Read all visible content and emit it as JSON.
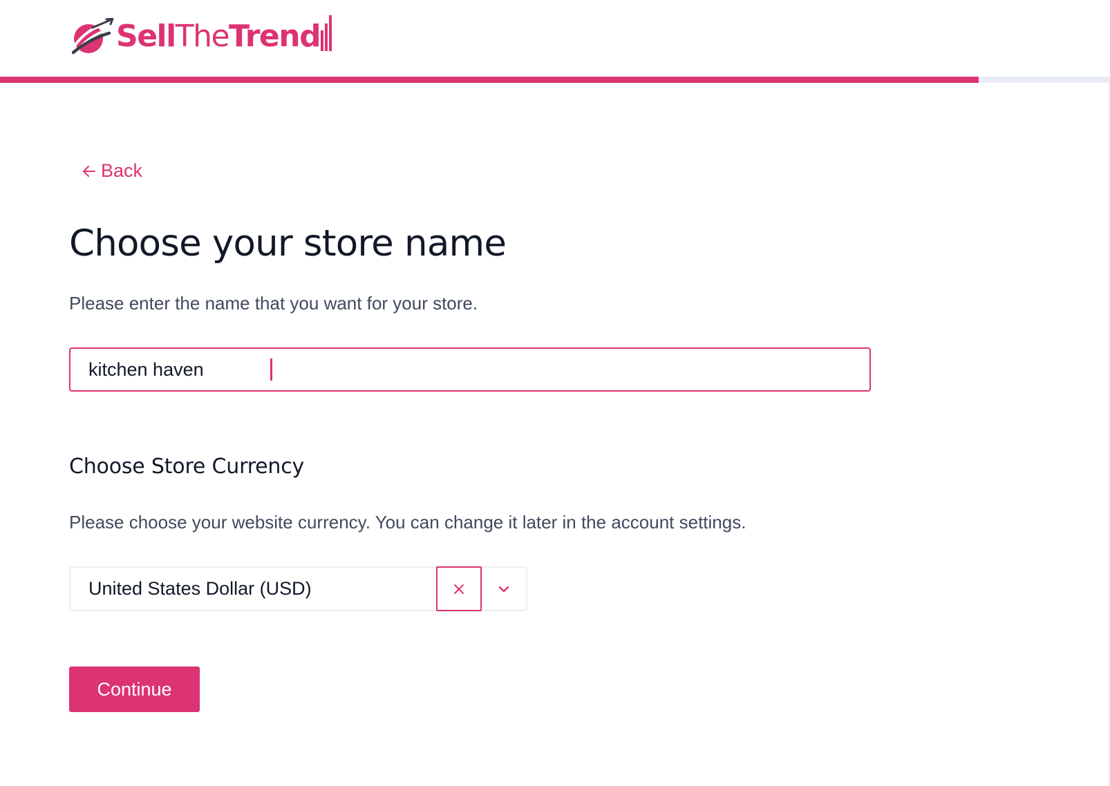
{
  "brand": {
    "logo_part1": "Sell",
    "logo_part2": "The",
    "logo_part3": "Trend",
    "accent_color": "#dc3372",
    "logo_mark_icon": "rocket-swoosh-icon"
  },
  "progress": {
    "fraction": 0.8817
  },
  "back": {
    "label": "Back",
    "icon": "arrow-left-icon"
  },
  "store_name": {
    "title": "Choose your store name",
    "description": "Please enter the name that you want for your store.",
    "value": "kitchen haven"
  },
  "currency": {
    "title": "Choose Store Currency",
    "description": "Please choose your website currency. You can change it later in the account settings.",
    "selected": "United States Dollar (USD)",
    "clear_icon": "close-icon",
    "dropdown_icon": "chevron-down-icon"
  },
  "actions": {
    "continue_label": "Continue"
  }
}
